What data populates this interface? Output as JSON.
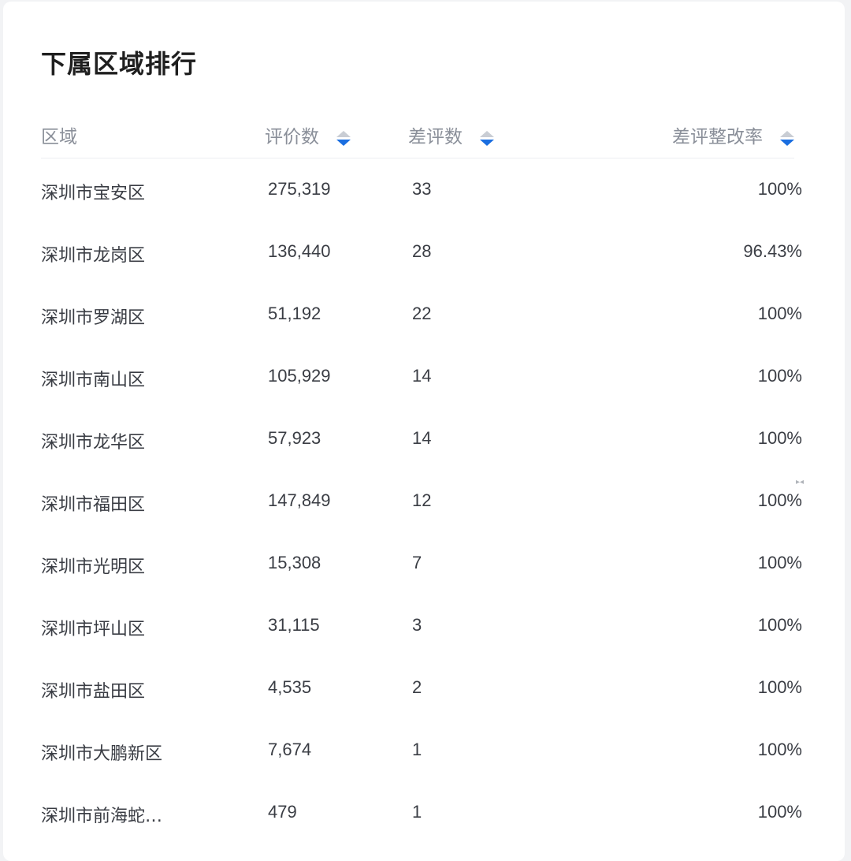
{
  "title": "下属区域排行",
  "columns": {
    "region": "区域",
    "reviews": "评价数",
    "bad_reviews": "差评数",
    "rectify_rate": "差评整改率"
  },
  "sort_icon": "sort-caret-icon",
  "accent_color": "#1a6ee0",
  "rows": [
    {
      "region": "深圳市宝安区",
      "reviews": "275,319",
      "bad": "33",
      "rate": "100%"
    },
    {
      "region": "深圳市龙岗区",
      "reviews": "136,440",
      "bad": "28",
      "rate": "96.43%"
    },
    {
      "region": "深圳市罗湖区",
      "reviews": "51,192",
      "bad": "22",
      "rate": "100%"
    },
    {
      "region": "深圳市南山区",
      "reviews": "105,929",
      "bad": "14",
      "rate": "100%"
    },
    {
      "region": "深圳市龙华区",
      "reviews": "57,923",
      "bad": "14",
      "rate": "100%"
    },
    {
      "region": "深圳市福田区",
      "reviews": "147,849",
      "bad": "12",
      "rate": "100%"
    },
    {
      "region": "深圳市光明区",
      "reviews": "15,308",
      "bad": "7",
      "rate": "100%"
    },
    {
      "region": "深圳市坪山区",
      "reviews": "31,115",
      "bad": "3",
      "rate": "100%"
    },
    {
      "region": "深圳市盐田区",
      "reviews": "4,535",
      "bad": "2",
      "rate": "100%"
    },
    {
      "region": "深圳市大鹏新区",
      "reviews": "7,674",
      "bad": "1",
      "rate": "100%"
    },
    {
      "region": "深圳市前海蛇…",
      "reviews": "479",
      "bad": "1",
      "rate": "100%"
    }
  ]
}
